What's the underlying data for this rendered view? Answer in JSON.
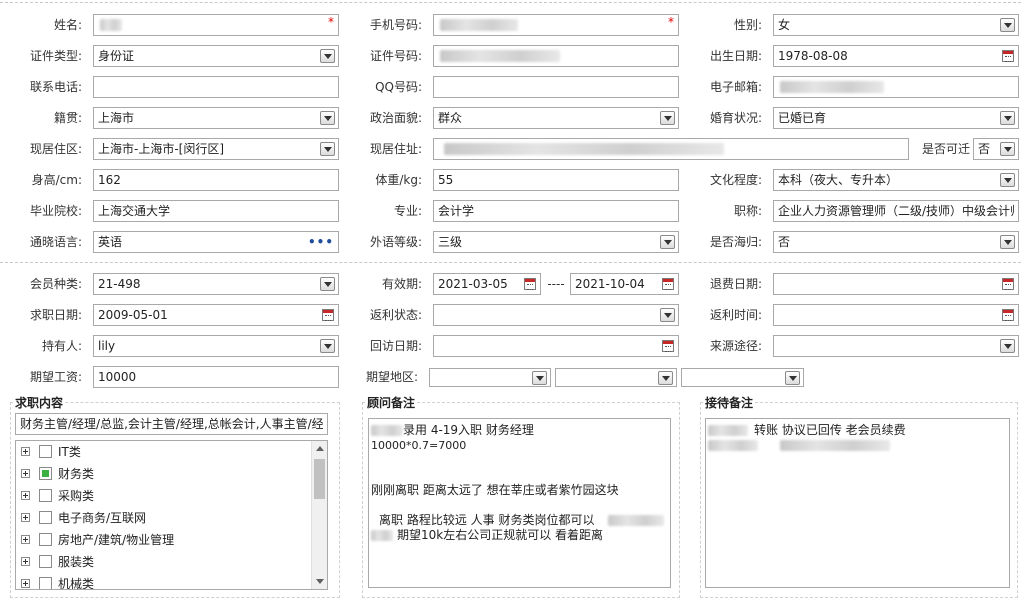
{
  "basic": {
    "name": {
      "label": "姓名:"
    },
    "phone": {
      "label": "手机号码:"
    },
    "gender": {
      "label": "性别:",
      "value": "女"
    },
    "id_type": {
      "label": "证件类型:",
      "value": "身份证"
    },
    "id_no": {
      "label": "证件号码:"
    },
    "birth": {
      "label": "出生日期:",
      "value": "1978-08-08"
    },
    "tel": {
      "label": "联系电话:",
      "value": ""
    },
    "qq": {
      "label": "QQ号码:",
      "value": ""
    },
    "email": {
      "label": "电子邮箱:"
    },
    "native": {
      "label": "籍贯:",
      "value": "上海市"
    },
    "political": {
      "label": "政治面貌:",
      "value": "群众"
    },
    "marital": {
      "label": "婚育状况:",
      "value": "已婚已育"
    },
    "residence_area": {
      "label": "现居住区:",
      "value": "上海市-上海市-[闵行区]"
    },
    "address": {
      "label": "现居住址:"
    },
    "can_relocate": {
      "label": "是否可迁",
      "value": "否"
    },
    "height": {
      "label": "身高/cm:",
      "value": "162"
    },
    "weight": {
      "label": "体重/kg:",
      "value": "55"
    },
    "education": {
      "label": "文化程度:",
      "value": "本科（夜大、专升本）"
    },
    "school": {
      "label": "毕业院校:",
      "value": "上海交通大学"
    },
    "major": {
      "label": "专业:",
      "value": "会计学"
    },
    "title": {
      "label": "职称:",
      "value": "企业人力资源管理师（二级/技师）中级会计师"
    },
    "language": {
      "label": "通晓语言:",
      "value": "英语"
    },
    "lang_level": {
      "label": "外语等级:",
      "value": "三级"
    },
    "overseas": {
      "label": "是否海归:",
      "value": "否"
    }
  },
  "member": {
    "type": {
      "label": "会员种类:",
      "value": "21-498"
    },
    "validity": {
      "label": "有效期:",
      "from": "2021-03-05",
      "sep": "----",
      "to": "2021-10-04"
    },
    "refund_date": {
      "label": "退费日期:",
      "value": ""
    },
    "job_date": {
      "label": "求职日期:",
      "value": "2009-05-01"
    },
    "rebate_status": {
      "label": "返利状态:",
      "value": ""
    },
    "rebate_time": {
      "label": "返利时间:",
      "value": ""
    },
    "holder": {
      "label": "持有人:",
      "value": "lily"
    },
    "visit_date": {
      "label": "回访日期:",
      "value": ""
    },
    "source": {
      "label": "来源途径:",
      "value": ""
    },
    "salary": {
      "label": "期望工资:",
      "value": "10000"
    },
    "area": {
      "label": "期望地区:"
    }
  },
  "job_content": {
    "legend": "求职内容",
    "selected": "财务主管/经理/总监,会计主管/经理,总帐会计,人事主管/经理",
    "items": [
      {
        "label": "IT类",
        "checked": false
      },
      {
        "label": "财务类",
        "checked": true
      },
      {
        "label": "采购类",
        "checked": false
      },
      {
        "label": "电子商务/互联网",
        "checked": false
      },
      {
        "label": "房地产/建筑/物业管理",
        "checked": false
      },
      {
        "label": "服装类",
        "checked": false
      },
      {
        "label": "机械类",
        "checked": false
      }
    ]
  },
  "advisor_notes": {
    "legend": "顾问备注",
    "line1": "录用   4-19入职   财务经理",
    "line2": "10000*0.7=7000",
    "line3": "刚刚离职  距离太远了  想在莘庄或者紫竹园这块",
    "line4": "离职  路程比较远  人事  财务类岗位都可以",
    "line5": "期望10k左右公司正规就可以  看着距离"
  },
  "reception_notes": {
    "legend": "接待备注",
    "line1": "转账  协议已回传      老会员续费"
  }
}
